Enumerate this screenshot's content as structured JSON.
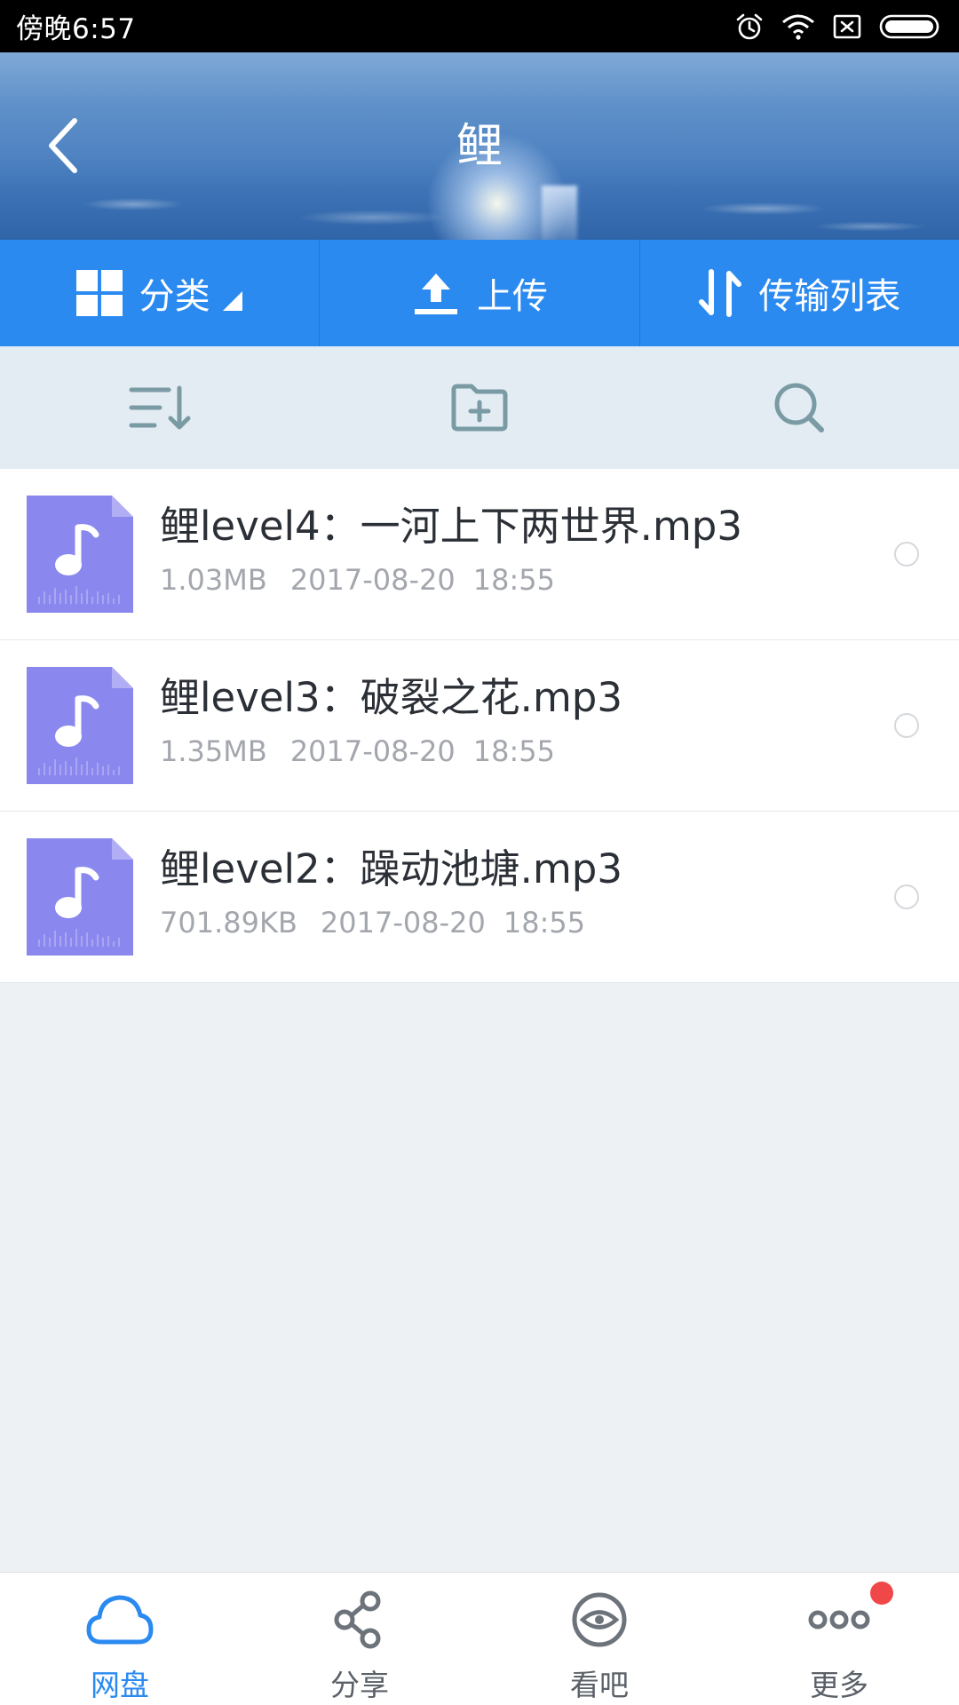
{
  "status_bar": {
    "time": "傍晚6:57",
    "icons": [
      "alarm-icon",
      "wifi-icon",
      "sim-disabled-icon",
      "battery-icon"
    ]
  },
  "header": {
    "title": "鲤",
    "back_icon": "chevron-left-icon"
  },
  "action_bar": {
    "items": [
      {
        "label": "分类",
        "icon": "grid-icon",
        "has_dropdown": true
      },
      {
        "label": "上传",
        "icon": "upload-icon"
      },
      {
        "label": "传输列表",
        "icon": "transfer-icon"
      }
    ]
  },
  "tool_bar": {
    "items": [
      "sort-icon",
      "new-folder-icon",
      "search-icon"
    ]
  },
  "files": [
    {
      "name": "鲤level4：一河上下两世界.mp3",
      "size": "1.03MB",
      "date": "2017-08-20",
      "time": "18:55"
    },
    {
      "name": "鲤level3：破裂之花.mp3",
      "size": "1.35MB",
      "date": "2017-08-20",
      "time": "18:55"
    },
    {
      "name": "鲤level2：躁动池塘.mp3",
      "size": "701.89KB",
      "date": "2017-08-20",
      "time": "18:55"
    }
  ],
  "bottom_nav": {
    "items": [
      {
        "label": "网盘",
        "icon": "cloud-icon",
        "active": true
      },
      {
        "label": "分享",
        "icon": "share-icon",
        "active": false
      },
      {
        "label": "看吧",
        "icon": "eye-icon",
        "active": false
      },
      {
        "label": "更多",
        "icon": "more-icon",
        "active": false,
        "badge": true
      }
    ]
  },
  "colors": {
    "accent": "#2b8af0",
    "file_icon": "#8a87ee",
    "badge": "#f04848"
  }
}
